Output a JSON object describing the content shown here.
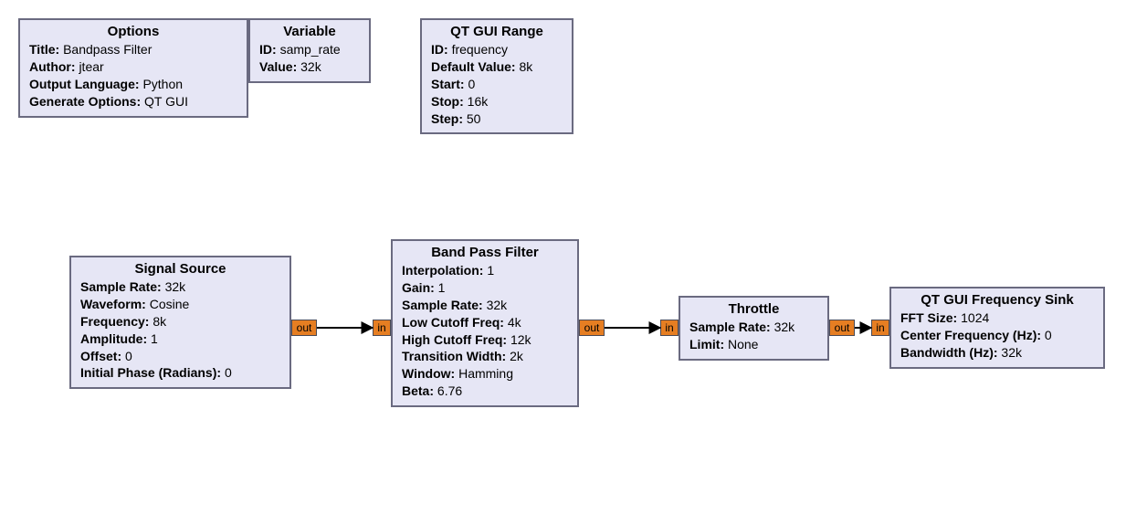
{
  "blocks": {
    "options": {
      "title": "Options",
      "fields": [
        {
          "k": "Title:",
          "v": "Bandpass Filter"
        },
        {
          "k": "Author:",
          "v": "jtear"
        },
        {
          "k": "Output Language:",
          "v": "Python"
        },
        {
          "k": "Generate Options:",
          "v": "QT GUI"
        }
      ]
    },
    "variable": {
      "title": "Variable",
      "fields": [
        {
          "k": "ID:",
          "v": "samp_rate"
        },
        {
          "k": "Value:",
          "v": "32k"
        }
      ]
    },
    "range": {
      "title": "QT GUI Range",
      "fields": [
        {
          "k": "ID:",
          "v": "frequency"
        },
        {
          "k": "Default Value:",
          "v": "8k"
        },
        {
          "k": "Start:",
          "v": "0"
        },
        {
          "k": "Stop:",
          "v": "16k"
        },
        {
          "k": "Step:",
          "v": "50"
        }
      ]
    },
    "source": {
      "title": "Signal Source",
      "fields": [
        {
          "k": "Sample Rate:",
          "v": "32k"
        },
        {
          "k": "Waveform:",
          "v": "Cosine"
        },
        {
          "k": "Frequency:",
          "v": "8k"
        },
        {
          "k": "Amplitude:",
          "v": "1"
        },
        {
          "k": "Offset:",
          "v": "0"
        },
        {
          "k": "Initial Phase (Radians):",
          "v": "0"
        }
      ]
    },
    "bpf": {
      "title": "Band Pass Filter",
      "fields": [
        {
          "k": "Interpolation:",
          "v": "1"
        },
        {
          "k": "Gain:",
          "v": "1"
        },
        {
          "k": "Sample Rate:",
          "v": "32k"
        },
        {
          "k": "Low Cutoff Freq:",
          "v": "4k"
        },
        {
          "k": "High Cutoff Freq:",
          "v": "12k"
        },
        {
          "k": "Transition Width:",
          "v": "2k"
        },
        {
          "k": "Window:",
          "v": "Hamming"
        },
        {
          "k": "Beta:",
          "v": "6.76"
        }
      ]
    },
    "throttle": {
      "title": "Throttle",
      "fields": [
        {
          "k": "Sample Rate:",
          "v": "32k"
        },
        {
          "k": "Limit:",
          "v": "None"
        }
      ]
    },
    "sink": {
      "title": "QT GUI Frequency Sink",
      "fields": [
        {
          "k": "FFT Size:",
          "v": "1024"
        },
        {
          "k": "Center Frequency (Hz):",
          "v": "0"
        },
        {
          "k": "Bandwidth (Hz):",
          "v": "32k"
        }
      ]
    }
  },
  "port_labels": {
    "out": "out",
    "in": "in"
  }
}
